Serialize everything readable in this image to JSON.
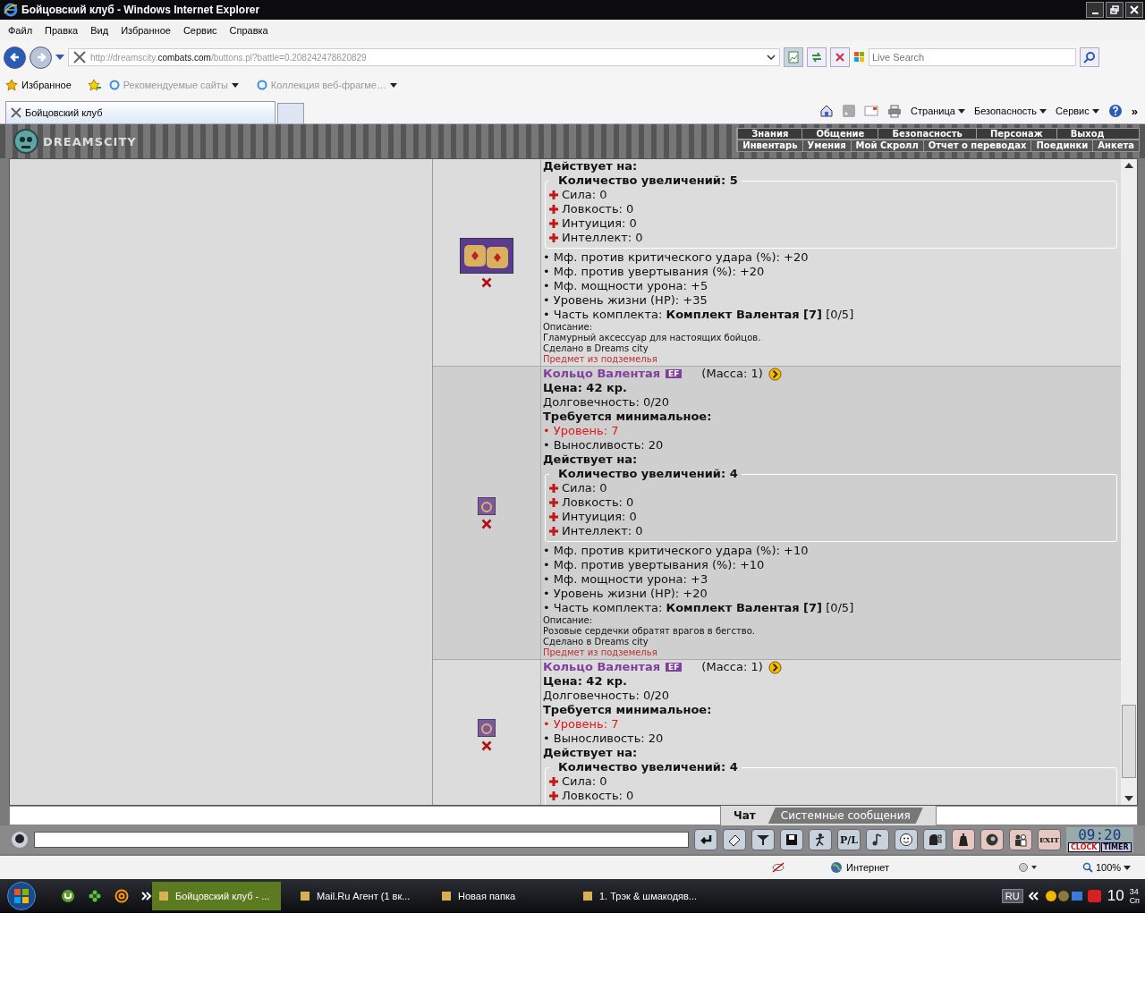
{
  "window": {
    "title": "Бойцовский клуб - Windows Internet Explorer"
  },
  "menu": [
    "Файл",
    "Правка",
    "Вид",
    "Избранное",
    "Сервис",
    "Справка"
  ],
  "address": {
    "url_prefix": "http://dreamscity.",
    "url_host": "combats.com",
    "url_path": "/buttons.pl?battle=0.208242478620829"
  },
  "search": {
    "placeholder": "Live Search"
  },
  "favorites": {
    "label": "Избранное",
    "links": [
      "Рекомендуемые сайты",
      "Коллекция веб-фрагме…"
    ]
  },
  "tabs": [
    {
      "label": "Бойцовский клуб",
      "selected": true
    }
  ],
  "command_bar": [
    "Страница",
    "Безопасность",
    "Сервис"
  ],
  "more": "»",
  "game": {
    "logo": "DREAMSCITY",
    "nav_top": [
      "Знания",
      "Общение",
      "Безопасность",
      "Персонаж",
      "Выход"
    ],
    "nav_bottom": [
      "Инвентарь",
      "Умения",
      "Мой Скролл",
      "Отчет о переводах",
      "Поединки",
      "Анкета"
    ]
  },
  "items": [
    {
      "kind": "bracelets",
      "effects_title": "Действует на:",
      "boost_title": "Количество увеличений: 5",
      "stats": [
        "Сила: 0",
        "Ловкость: 0",
        "Интуиция: 0",
        "Интеллект: 0"
      ],
      "bonuses": [
        "• Мф. против критического удара (%): +20",
        "• Мф. против увертывания (%): +20",
        "• Мф. мощности урона: +5",
        "• Уровень жизни (HP): +35",
        "• Часть комплекта: **Комплект Валентая [7]** [0/5]"
      ],
      "desc_label": "Описание:",
      "description": "Гламурный аксессуар для настоящих бойцов.",
      "made": "Сделано в Dreams city",
      "origin": "Предмет из подземелья"
    },
    {
      "kind": "ring",
      "name": "Кольцо Валентая",
      "badge": "EF",
      "mass": "(Масса: 1)",
      "price": "Цена: 42 кр.",
      "durability": "Долговечность: 0/20",
      "req_title": "Требуется минимальное:",
      "requirements": [
        {
          "text": "• Уровень: 7",
          "met": false
        },
        {
          "text": "• Выносливость: 20",
          "met": true
        }
      ],
      "effects_title": "Действует на:",
      "boost_title": "Количество увеличений: 4",
      "stats": [
        "Сила: 0",
        "Ловкость: 0",
        "Интуиция: 0",
        "Интеллект: 0"
      ],
      "bonuses": [
        "• Мф. против критического удара (%): +10",
        "• Мф. против увертывания (%): +10",
        "• Мф. мощности урона: +3",
        "• Уровень жизни (HP): +20",
        "• Часть комплекта: **Комплект Валентая [7]** [0/5]"
      ],
      "desc_label": "Описание:",
      "description": "Розовые сердечки обратят врагов в бегство.",
      "made": "Сделано в Dreams city",
      "origin": "Предмет из подземелья"
    },
    {
      "kind": "ring",
      "name": "Кольцо Валентая",
      "badge": "EF",
      "mass": "(Масса: 1)",
      "price": "Цена: 42 кр.",
      "durability": "Долговечность: 0/20",
      "req_title": "Требуется минимальное:",
      "requirements": [
        {
          "text": "• Уровень: 7",
          "met": false
        },
        {
          "text": "• Выносливость: 20",
          "met": true
        }
      ],
      "effects_title": "Действует на:",
      "boost_title": "Количество увеличений: 4",
      "stats": [
        "Сила: 0",
        "Ловкость: 0"
      ]
    }
  ],
  "chat": {
    "tabs": [
      {
        "label": "Чат",
        "selected": true
      },
      {
        "label": "Системные сообщения",
        "selected": false
      }
    ],
    "tools": [
      {
        "kind": "enter"
      },
      {
        "kind": "eraser"
      },
      {
        "kind": "filter"
      },
      {
        "kind": "save"
      },
      {
        "kind": "dance"
      },
      {
        "kind": "pl",
        "label": "P/L"
      },
      {
        "kind": "music"
      },
      {
        "kind": "smiley"
      },
      {
        "kind": "helmet"
      },
      {
        "kind": "bag"
      },
      {
        "kind": "mask"
      },
      {
        "kind": "people"
      },
      {
        "kind": "exit",
        "label": "EXIT"
      }
    ],
    "clock": "09:20",
    "clock_label": "CLOCK",
    "timer_label": "TIMER"
  },
  "status": {
    "zone": "Интернет",
    "zoom": "100%"
  },
  "taskbar": {
    "tasks": [
      {
        "label": "Бойцовский клуб - ...",
        "selected": true
      },
      {
        "label": "Mail.Ru Агент (1 вк...",
        "selected": false
      },
      {
        "label": "Новая папка",
        "selected": false
      },
      {
        "label": "1. Трэк & шмакодяв...",
        "selected": false
      }
    ],
    "lang": "RU",
    "hours": "10",
    "minutes": "34",
    "day": "Сп"
  }
}
